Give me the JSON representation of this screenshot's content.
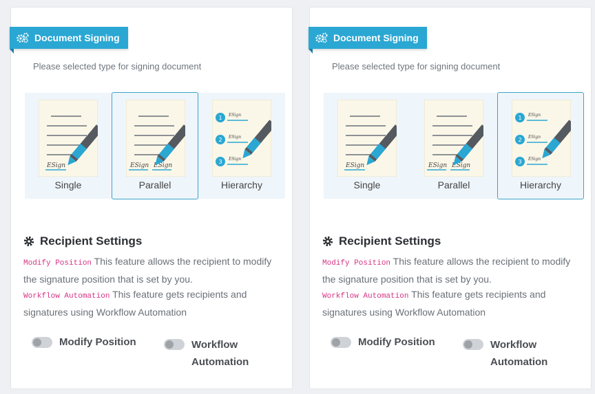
{
  "panels": [
    {
      "header": {
        "title": "Document Signing",
        "icon": "cogs-icon"
      },
      "hint": "Please selected type for signing document",
      "types": [
        {
          "label": "Single",
          "selected": false
        },
        {
          "label": "Parallel",
          "selected": true
        },
        {
          "label": "Hierarchy",
          "selected": false
        }
      ],
      "recipient": {
        "title": "Recipient Settings",
        "modify_code": "Modify Position",
        "modify_text": "This feature allows the recipient to modify the signature position that is set by you.",
        "workflow_code": "Workflow Automation",
        "workflow_text": "This feature gets recipients and signatures using Workflow Automation"
      },
      "toggles": {
        "modify": "Modify Position",
        "workflow_1": "Workflow",
        "workflow_2": "Automation"
      }
    },
    {
      "header": {
        "title": "Document Signing",
        "icon": "cogs-icon"
      },
      "hint": "Please selected type for signing document",
      "types": [
        {
          "label": "Single",
          "selected": false
        },
        {
          "label": "Parallel",
          "selected": false
        },
        {
          "label": "Hierarchy",
          "selected": true
        }
      ],
      "recipient": {
        "title": "Recipient Settings",
        "modify_code": "Modify Position",
        "modify_text": "This feature allows the recipient to modify the signature position that is set by you.",
        "workflow_code": "Workflow Automation",
        "workflow_text": "This feature gets recipients and signatures using Workflow Automation"
      },
      "toggles": {
        "modify": "Modify Position",
        "workflow_1": "Workflow",
        "workflow_2": "Automation"
      }
    }
  ],
  "doc_text": {
    "single_sig": "ESign",
    "par_sig_1": "ESign",
    "par_sig_2": "ESign",
    "hier_1": "1",
    "hier_2": "2",
    "hier_3": "3",
    "hier_sig": "ESign"
  },
  "colors": {
    "accent": "#2aa7d3",
    "selected_border": "#3da3c8",
    "code": "#d63384"
  }
}
